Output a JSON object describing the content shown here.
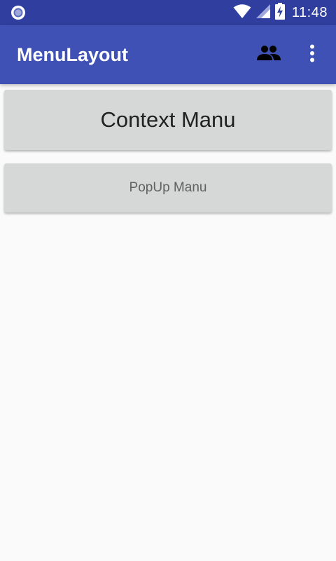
{
  "status_bar": {
    "time": "11:48",
    "notification_icon": "circle-notification-icon",
    "icons": [
      "wifi-icon",
      "cell-signal-icon",
      "battery-charging-icon"
    ]
  },
  "app_bar": {
    "title": "MenuLayout",
    "actions": [
      "people-icon",
      "more-vert-icon"
    ]
  },
  "main": {
    "context_button_label": "Context Manu",
    "popup_button_label": "PopUp Manu"
  },
  "colors": {
    "status_bar": "#303f9f",
    "app_bar": "#3f51b5",
    "button_bg": "#d6d7d7",
    "background": "#fafafa"
  }
}
